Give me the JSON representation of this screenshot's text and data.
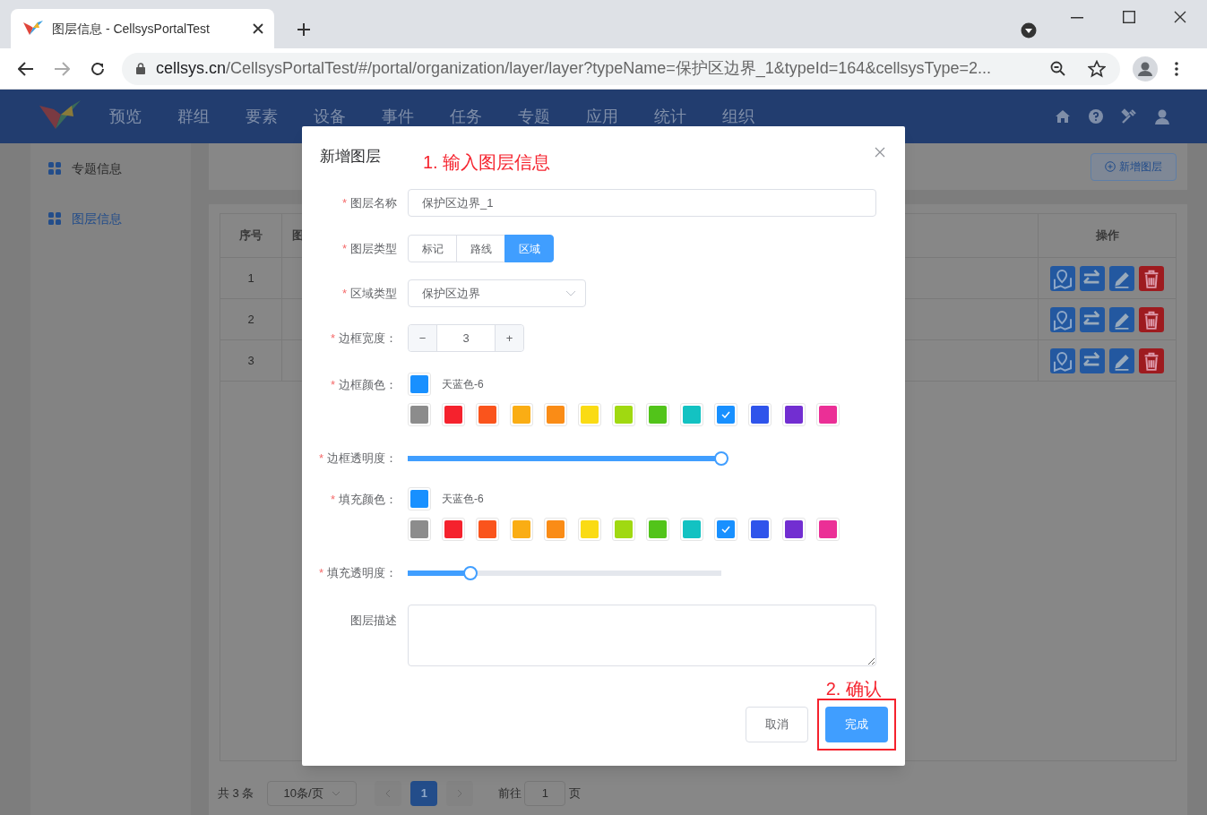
{
  "browser": {
    "tab_title": "图层信息 - CellsysPortalTest",
    "url_host": "cellsys.cn",
    "url_path": "/CellsysPortalTest/#/portal/organization/layer/layer?typeName=保护区边界_1&typeId=164&cellsysType=2..."
  },
  "nav": {
    "items": [
      {
        "label": "预览"
      },
      {
        "label": "群组"
      },
      {
        "label": "要素"
      },
      {
        "label": "设备"
      },
      {
        "label": "事件"
      },
      {
        "label": "任务"
      },
      {
        "label": "专题"
      },
      {
        "label": "应用"
      },
      {
        "label": "统计"
      },
      {
        "label": "组织"
      }
    ]
  },
  "sidebar": {
    "items": [
      {
        "label": "专题信息",
        "selected": false
      },
      {
        "label": "图层信息",
        "selected": true
      }
    ]
  },
  "toolbar": {
    "add_button": "新增图层"
  },
  "table": {
    "columns": [
      "序号",
      "图",
      "操作"
    ],
    "rows": [
      {
        "number": "1"
      },
      {
        "number": "2"
      },
      {
        "number": "3"
      }
    ]
  },
  "pagination": {
    "total": "共 3 条",
    "page_size": "10条/页",
    "pages": [
      {
        "label": "1",
        "selected": true
      }
    ],
    "goto_label": "前往",
    "goto_value": "1",
    "goto_suffix": "页"
  },
  "dialog": {
    "title": "新增图层",
    "annotation_1": "1. 输入图层信息",
    "name": {
      "required_mark": "*",
      "label": "图层名称",
      "value": "保护区边界_1"
    },
    "type": {
      "required_mark": "*",
      "label": "图层类型",
      "options": [
        {
          "label": "标记",
          "selected": false
        },
        {
          "label": "路线",
          "selected": false
        },
        {
          "label": "区域",
          "selected": true
        }
      ]
    },
    "region_type": {
      "required_mark": "*",
      "label": "区域类型",
      "value": "保护区边界"
    },
    "border_width": {
      "required_mark": "*",
      "label": "边框宽度：",
      "value": "3",
      "minus": "−",
      "plus": "+"
    },
    "border_color": {
      "required_mark": "*",
      "label": "边框颜色：",
      "current_name": "天蓝色-6",
      "swatches": [
        {
          "color": "#8c8c8c",
          "selected": false
        },
        {
          "color": "#f5222d",
          "selected": false
        },
        {
          "color": "#fa541c",
          "selected": false
        },
        {
          "color": "#faad14",
          "selected": false
        },
        {
          "color": "#fa8c16",
          "selected": false
        },
        {
          "color": "#fadb14",
          "selected": false
        },
        {
          "color": "#a0d911",
          "selected": false
        },
        {
          "color": "#52c41a",
          "selected": false
        },
        {
          "color": "#13c2c2",
          "selected": false
        },
        {
          "color": "#1890ff",
          "selected": true
        },
        {
          "color": "#2f54eb",
          "selected": false
        },
        {
          "color": "#722ed1",
          "selected": false
        },
        {
          "color": "#eb2f96",
          "selected": false
        }
      ]
    },
    "border_opacity": {
      "required_mark": "*",
      "label": "边框透明度：",
      "level": 1.0
    },
    "fill_color": {
      "required_mark": "*",
      "label": "填充颜色：",
      "current_name": "天蓝色-6",
      "swatches": [
        {
          "color": "#8c8c8c",
          "selected": false
        },
        {
          "color": "#f5222d",
          "selected": false
        },
        {
          "color": "#fa541c",
          "selected": false
        },
        {
          "color": "#faad14",
          "selected": false
        },
        {
          "color": "#fa8c16",
          "selected": false
        },
        {
          "color": "#fadb14",
          "selected": false
        },
        {
          "color": "#a0d911",
          "selected": false
        },
        {
          "color": "#52c41a",
          "selected": false
        },
        {
          "color": "#13c2c2",
          "selected": false
        },
        {
          "color": "#1890ff",
          "selected": true
        },
        {
          "color": "#2f54eb",
          "selected": false
        },
        {
          "color": "#722ed1",
          "selected": false
        },
        {
          "color": "#eb2f96",
          "selected": false
        }
      ]
    },
    "fill_opacity": {
      "required_mark": "*",
      "label": "填充透明度：",
      "level": 0.2
    },
    "description": {
      "label": "图层描述"
    },
    "annotation_2": "2. 确认",
    "cancel": "取消",
    "confirm": "完成"
  }
}
